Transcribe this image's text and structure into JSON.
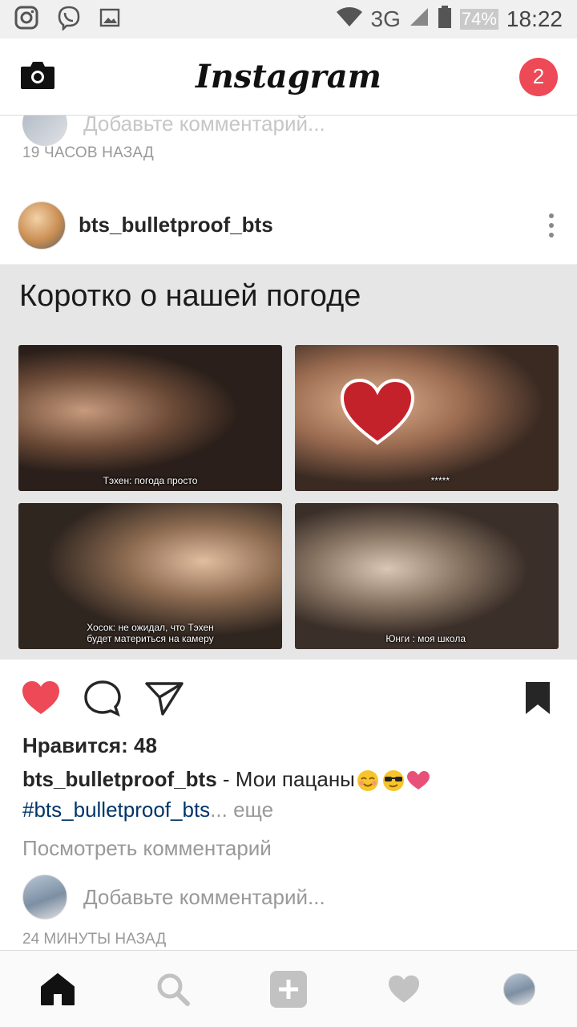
{
  "status_bar": {
    "network": "3G",
    "battery": "74%",
    "time": "18:22",
    "icons": [
      "instagram-icon",
      "viber-icon",
      "gallery-icon",
      "wifi-icon",
      "signal-icon",
      "battery-icon"
    ]
  },
  "header": {
    "logo": "Instagram",
    "notifications_count": "2"
  },
  "previous_post": {
    "comment_placeholder": "Добавьте комментарий...",
    "time": "19 ЧАСОВ НАЗАД"
  },
  "post": {
    "username": "bts_bulletproof_bts",
    "image": {
      "caption": "Коротко о нашей погоде",
      "frames": [
        {
          "subtitle": "Тэхен: погода просто"
        },
        {
          "subtitle": "*****"
        },
        {
          "subtitle": "Хосок: не ожидал, что Тэхен будет материться на камеру"
        },
        {
          "subtitle": "Юнги : моя школа"
        }
      ]
    },
    "likes": "Нравится: 48",
    "caption_user": "bts_bulletproof_bts",
    "caption_text": " - Мои пацаны",
    "hashtag": "#bts_bulletproof_bts",
    "more": "... еще",
    "view_comments": "Посмотреть комментарий",
    "add_comment_placeholder": "Добавьте комментарий...",
    "time": "24 МИНУТЫ НАЗАД",
    "liked": true
  },
  "colors": {
    "like_red": "#ed4956",
    "badge_red": "#ed4956",
    "hashtag_blue": "#003569",
    "muted_gray": "#999999"
  }
}
